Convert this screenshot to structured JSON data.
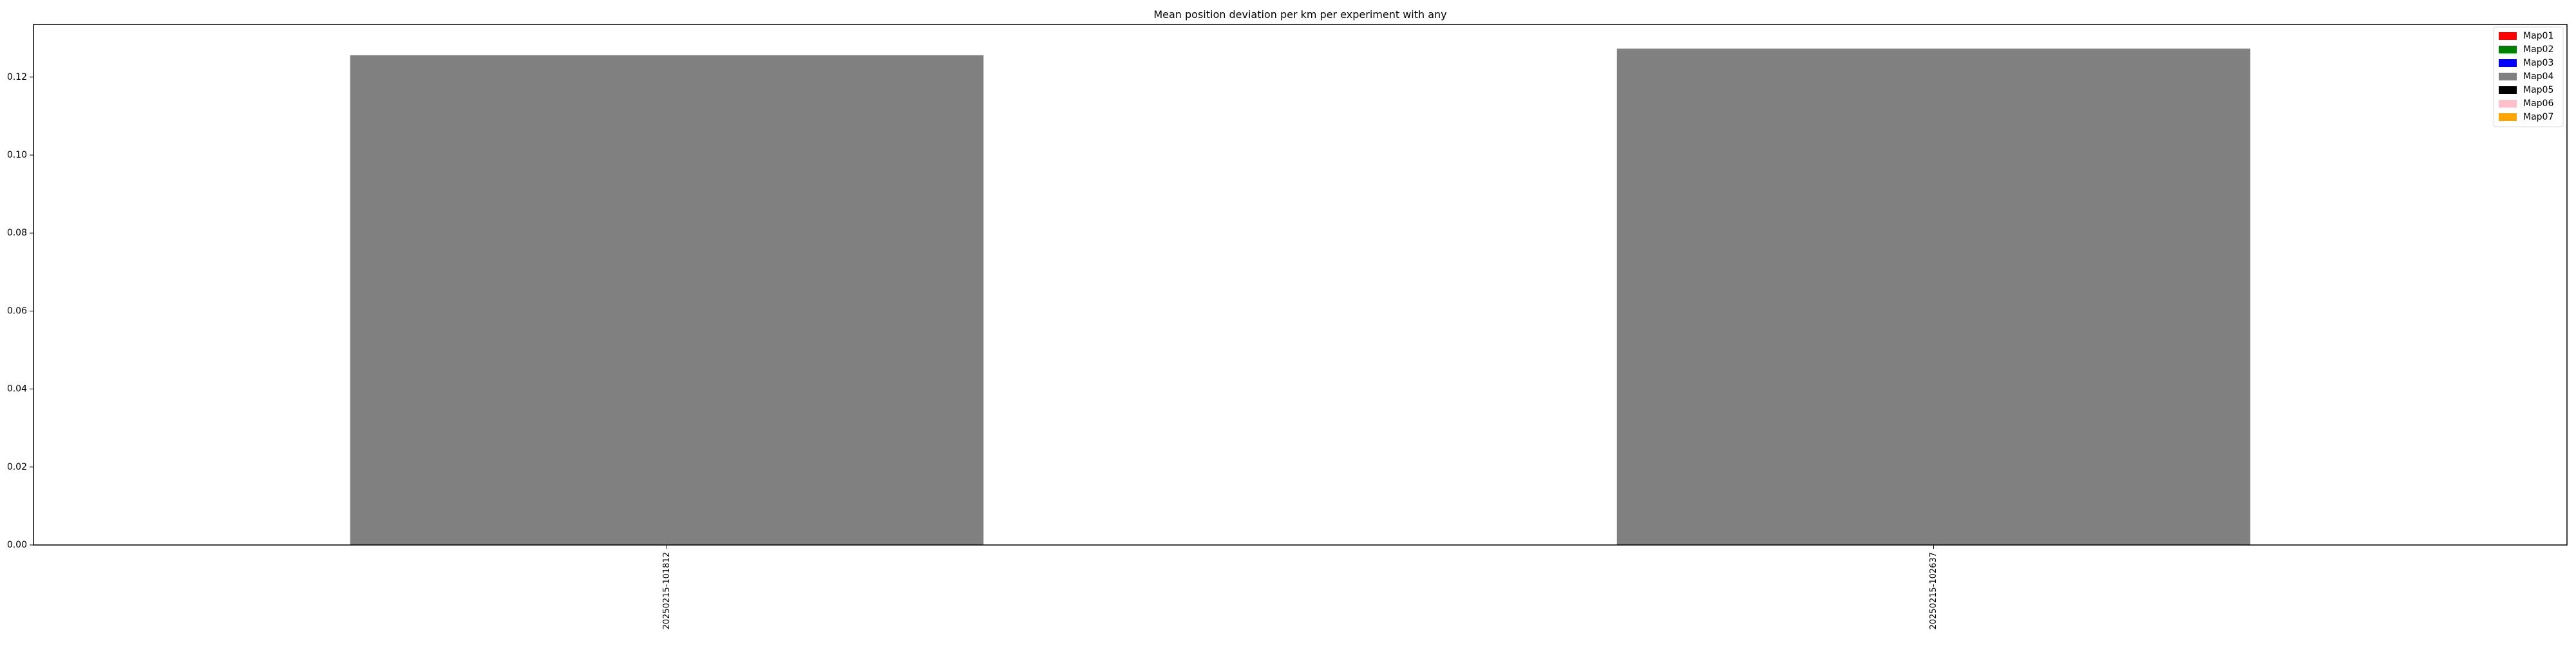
{
  "chart_data": {
    "type": "bar",
    "title": "Mean position deviation per km per experiment with any",
    "xlabel": "",
    "ylabel": "",
    "categories": [
      "20250215-101812",
      "20250215-102637"
    ],
    "values": [
      0.1256,
      0.1273
    ],
    "bar_color": "#808080",
    "ylim": [
      0,
      0.1335
    ],
    "yticks": [
      0.0,
      0.02,
      0.04,
      0.06,
      0.08,
      0.1,
      0.12
    ],
    "ytick_labels": [
      "0.00",
      "0.02",
      "0.04",
      "0.06",
      "0.08",
      "0.10",
      "0.12"
    ],
    "grid": false,
    "legend": {
      "position": "top-right",
      "entries": [
        {
          "label": "Map01",
          "color": "#ff0000"
        },
        {
          "label": "Map02",
          "color": "#008000"
        },
        {
          "label": "Map03",
          "color": "#0000ff"
        },
        {
          "label": "Map04",
          "color": "#808080"
        },
        {
          "label": "Map05",
          "color": "#000000"
        },
        {
          "label": "Map06",
          "color": "#ffc0cb"
        },
        {
          "label": "Map07",
          "color": "#ffa500"
        }
      ]
    }
  }
}
